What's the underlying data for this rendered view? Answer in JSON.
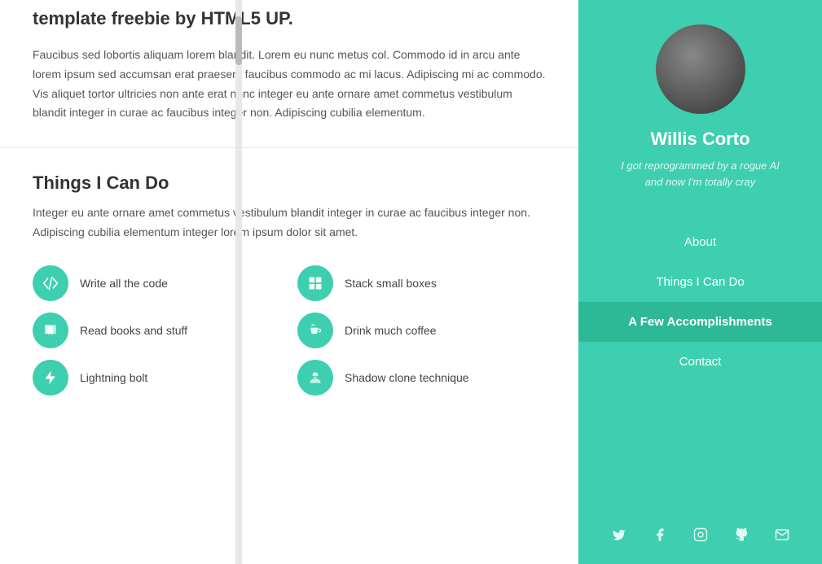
{
  "intro": {
    "title": "template freebie by HTML5 UP.",
    "body": "Faucibus sed lobortis aliquam lorem blandit. Lorem eu nunc metus col. Commodo id in arcu ante lorem ipsum sed accumsan erat praesent faucibus commodo ac mi lacus. Adipiscing mi ac commodo. Vis aliquet tortor ultricies non ante erat nunc integer eu ante ornare amet commetus vestibulum blandit integer in curae ac faucibus integer non. Adipiscing cubilia elementum."
  },
  "skills": {
    "title": "Things I Can Do",
    "description": "Integer eu ante ornare amet commetus vestibulum blandit integer in curae ac faucibus integer non. Adipiscing cubilia elementum integer lorem ipsum dolor sit amet.",
    "items": [
      {
        "icon": "code",
        "label": "Write all the code"
      },
      {
        "icon": "boxes",
        "label": "Stack small boxes"
      },
      {
        "icon": "book",
        "label": "Read books and stuff"
      },
      {
        "icon": "coffee",
        "label": "Drink much coffee"
      },
      {
        "icon": "bolt",
        "label": "Lightning bolt"
      },
      {
        "icon": "ninja",
        "label": "Shadow clone technique"
      }
    ]
  },
  "sidebar": {
    "name": "Willis Corto",
    "tagline": "I got reprogrammed by a rogue AI\nand now I'm totally cray",
    "nav": [
      {
        "label": "About",
        "active": false,
        "id": "about"
      },
      {
        "label": "Things I Can Do",
        "active": false,
        "id": "things"
      },
      {
        "label": "A Few Accomplishments",
        "active": true,
        "id": "accomplishments"
      },
      {
        "label": "Contact",
        "active": false,
        "id": "contact"
      }
    ],
    "social": [
      {
        "icon": "twitter",
        "symbol": "𝕏"
      },
      {
        "icon": "facebook",
        "symbol": "f"
      },
      {
        "icon": "instagram",
        "symbol": "📷"
      },
      {
        "icon": "github",
        "symbol": "⌥"
      },
      {
        "icon": "email",
        "symbol": "✉"
      }
    ]
  }
}
